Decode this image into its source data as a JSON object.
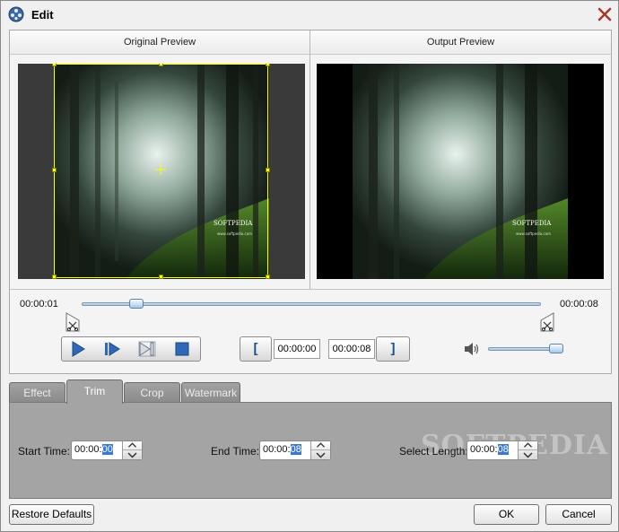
{
  "window": {
    "title": "Edit"
  },
  "preview": {
    "original_label": "Original Preview",
    "output_label": "Output Preview",
    "video_overlay_text": "SOFTPEDIA",
    "video_overlay_url": "www.softpedia.com"
  },
  "timeline": {
    "start_time": "00:00:01",
    "end_time": "00:00:08",
    "position_fraction": 0.12
  },
  "playback": {
    "start_box": "00:00:00",
    "end_box": "00:00:08",
    "start_bracket": "[",
    "end_bracket": "]",
    "volume_fraction": 0.9
  },
  "tabs": [
    {
      "label": "Effect"
    },
    {
      "label": "Trim"
    },
    {
      "label": "Crop"
    },
    {
      "label": "Watermark"
    }
  ],
  "active_tab": "Trim",
  "trim": {
    "start_label": "Start Time:",
    "start_prefix": "00:00:",
    "start_selected": "00",
    "end_label": "End Time:",
    "end_prefix": "00:00:",
    "end_selected": "08",
    "length_label": "Select Length:",
    "length_prefix": "00:00:",
    "length_selected": "08"
  },
  "watermark_text": "SOFTPEDIA",
  "buttons": {
    "restore": "Restore Defaults",
    "ok": "OK",
    "cancel": "Cancel"
  },
  "colors": {
    "tab_panel": "#a4a4a4",
    "crop_box": "#ffff00",
    "selection": "#3a78d6"
  }
}
